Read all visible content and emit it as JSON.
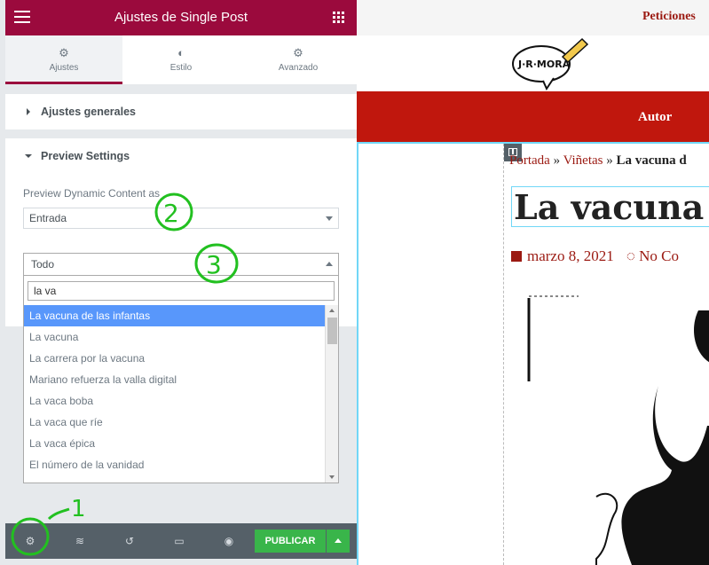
{
  "panel": {
    "title": "Ajustes de Single Post",
    "tabs": [
      {
        "label": "Ajustes",
        "icon": "gear-icon"
      },
      {
        "label": "Estilo",
        "icon": "contrast-icon"
      },
      {
        "label": "Avanzado",
        "icon": "gear-icon"
      }
    ],
    "sections": {
      "general": "Ajustes generales",
      "preview": "Preview Settings"
    },
    "preview_label": "Preview Dynamic Content as",
    "content_type": "Entrada",
    "post_select": "Todo",
    "search_value": "la va",
    "options": [
      "La vacuna de las infantas",
      "La vacuna",
      "La carrera por la vacuna",
      "Mariano refuerza la valla digital",
      "La vaca boba",
      "La vaca que ríe",
      "La vaca épica",
      "El número de la vanidad"
    ],
    "publish_label": "PUBLICAR"
  },
  "annotations": [
    "1",
    "2",
    "3"
  ],
  "preview": {
    "top_link": "Peticiones",
    "logo_text": "J·R·MORA",
    "nav_item": "Autor",
    "breadcrumb": {
      "home": "Portada",
      "sep1": " » ",
      "cat": "Viñetas",
      "sep2": " » ",
      "current": "La vacuna d"
    },
    "title": "La vacuna d",
    "date": "marzo 8, 2021",
    "comments": "No Co"
  },
  "colors": {
    "header": "#9b0a3d",
    "publish": "#39b54a",
    "nav": "#c0170d",
    "highlight": "#5897fb"
  }
}
